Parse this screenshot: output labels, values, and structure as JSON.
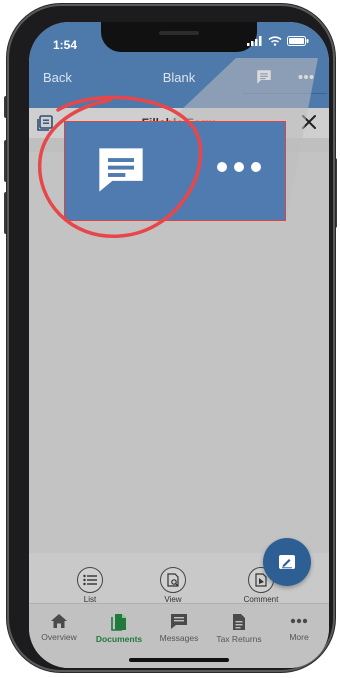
{
  "status_bar": {
    "time": "1:54"
  },
  "nav": {
    "back_label": "Back",
    "title": "Blank"
  },
  "document": {
    "title": "Fillable Form"
  },
  "tools": [
    {
      "label": "List",
      "icon": "list-icon"
    },
    {
      "label": "View",
      "icon": "view-icon"
    },
    {
      "label": "Comment",
      "icon": "comment-icon"
    }
  ],
  "tabs": [
    {
      "label": "Overview",
      "icon": "home-icon",
      "active": false
    },
    {
      "label": "Documents",
      "icon": "documents-icon",
      "active": true
    },
    {
      "label": "Messages",
      "icon": "messages-icon",
      "active": false
    },
    {
      "label": "Tax Returns",
      "icon": "tax-returns-icon",
      "active": false
    },
    {
      "label": "More",
      "icon": "more-icon",
      "active": false
    }
  ],
  "colors": {
    "header_blue": "#4e79ab",
    "fab_blue": "#2d5f94",
    "active_tab_green": "#1f7a3c",
    "annotation_red": "#e8474a"
  }
}
